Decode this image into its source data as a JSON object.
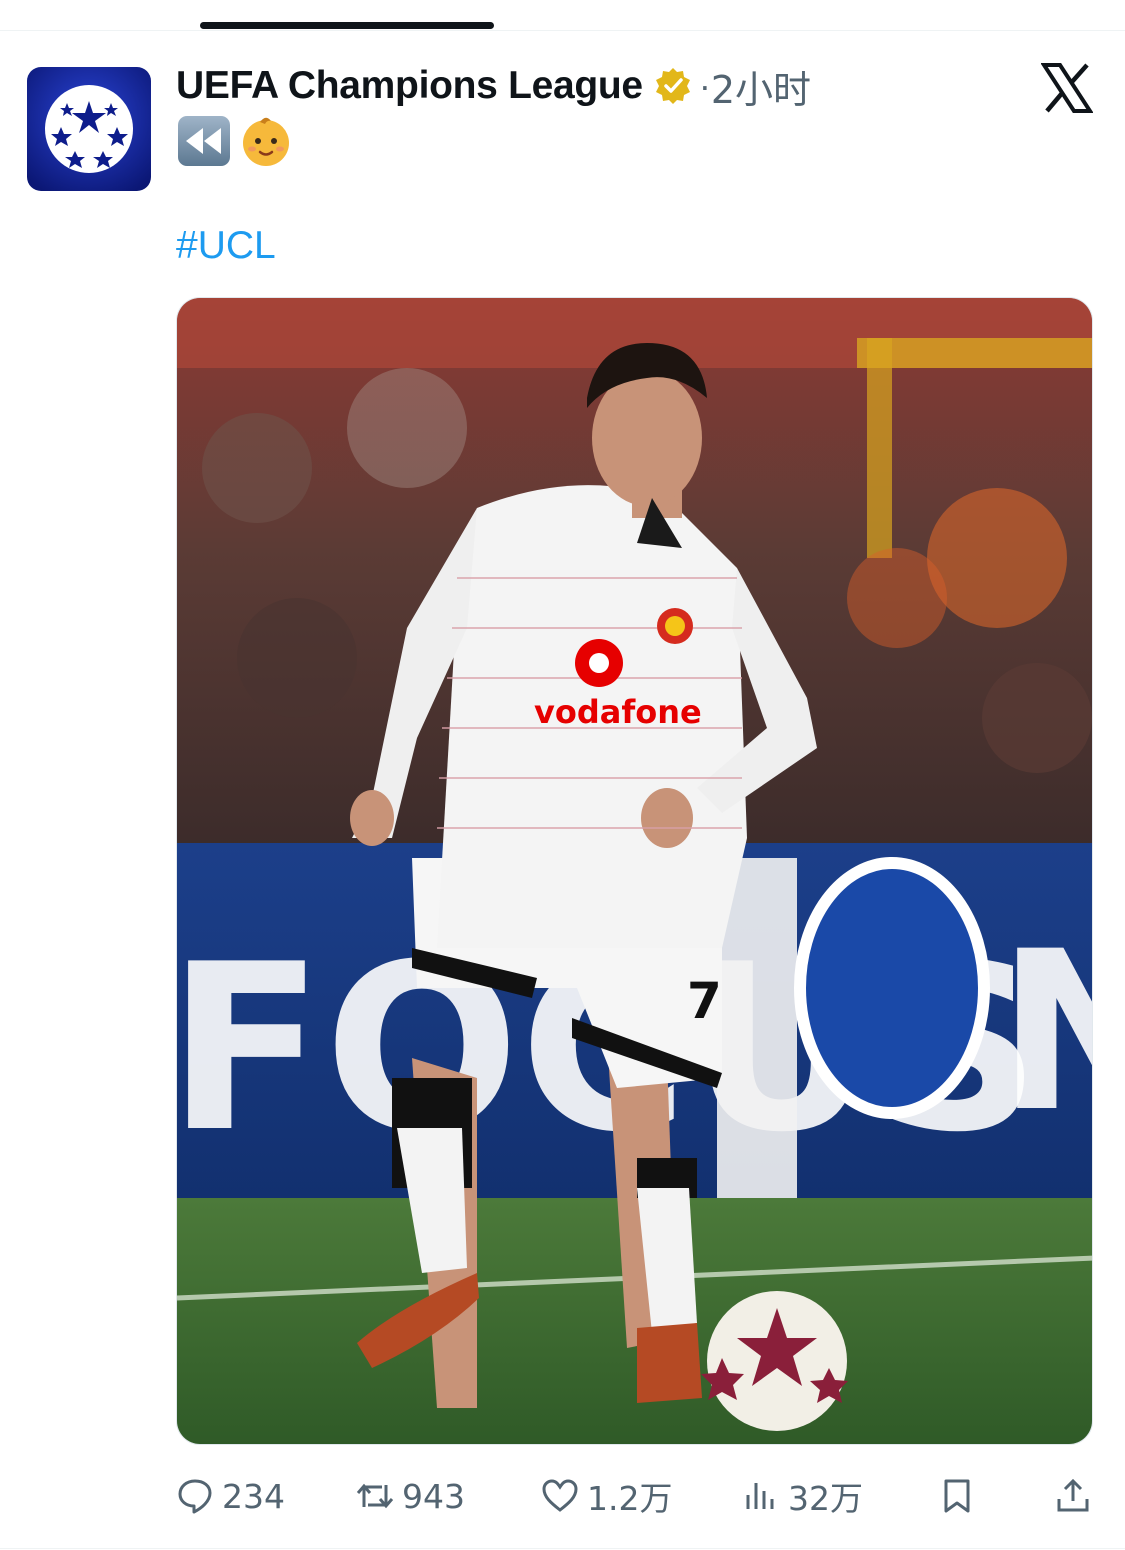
{
  "tweet": {
    "author_name": "UEFA Champions League",
    "separator": "·",
    "time": "2小时",
    "emoji_1": "rewind-emoji",
    "emoji_2": "baby-emoji",
    "hashtag": "#UCL",
    "image_alt_icon": "soccer-player-photo"
  },
  "actions": {
    "replies": "234",
    "retweets": "943",
    "likes": "1.2万",
    "views": "32万"
  },
  "colors": {
    "hashtag": "#1d9bf0",
    "verified": "#e2b719",
    "secondary_text": "#536471",
    "avatar_bg": "#1a2fb5"
  }
}
